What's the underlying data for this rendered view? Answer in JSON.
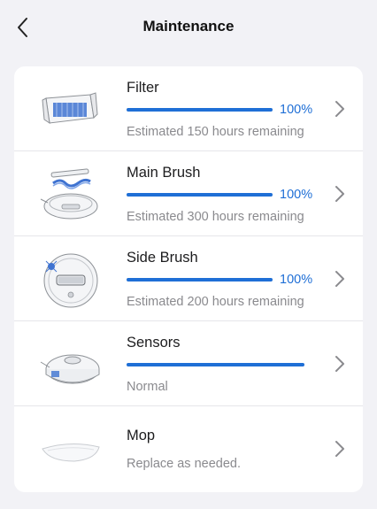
{
  "header": {
    "title": "Maintenance",
    "back_icon": "chevron-left-icon"
  },
  "accent_color": "#1f6fd6",
  "items": [
    {
      "name": "Filter",
      "percent": "100%",
      "level": 1.0,
      "status": "Estimated 150 hours remaining",
      "icon": "filter-icon"
    },
    {
      "name": "Main Brush",
      "percent": "100%",
      "level": 1.0,
      "status": "Estimated 300 hours remaining",
      "icon": "main-brush-icon"
    },
    {
      "name": "Side Brush",
      "percent": "100%",
      "level": 1.0,
      "status": "Estimated 200 hours remaining",
      "icon": "side-brush-icon"
    },
    {
      "name": "Sensors",
      "level": 1.0,
      "status": "Normal",
      "icon": "sensors-icon"
    },
    {
      "name": "Mop",
      "status": "Replace as needed.",
      "icon": "mop-icon"
    }
  ]
}
